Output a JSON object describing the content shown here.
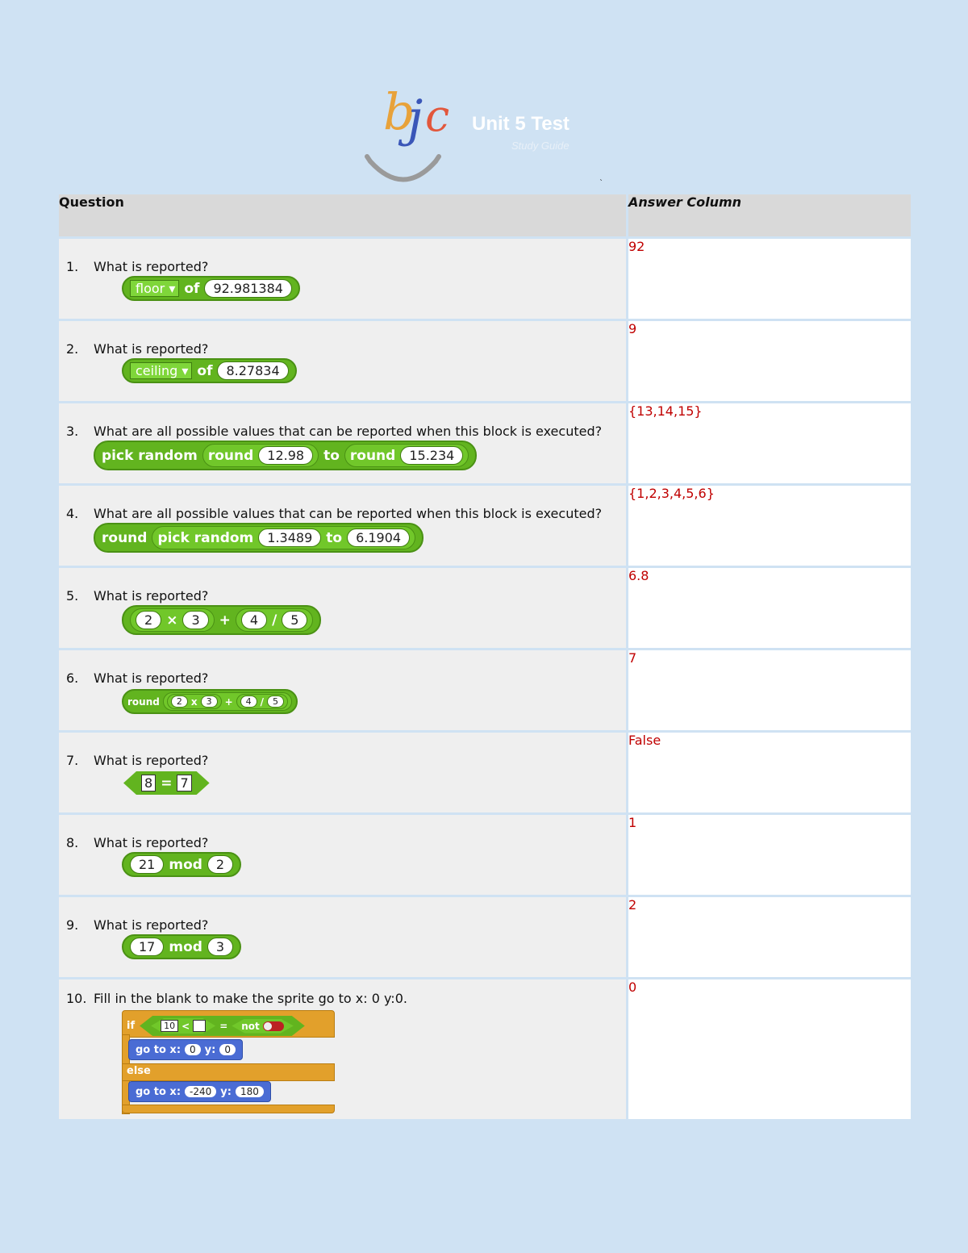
{
  "header": {
    "logo_text": "bjc",
    "title": "Unit 5 Test",
    "subtitle": "Study Guide",
    "tick_mark": "`"
  },
  "table": {
    "question_header": "Question",
    "answer_header": "Answer Column"
  },
  "questions": [
    {
      "num": "1.",
      "text": "What is reported?",
      "answer": "92",
      "block": {
        "op": "floor",
        "of": "of",
        "value": "92.981384"
      }
    },
    {
      "num": "2.",
      "text": "What is reported?",
      "answer": "9",
      "block": {
        "op": "ceiling",
        "of": "of",
        "value": "8.27834"
      }
    },
    {
      "num": "3.",
      "text": "What are all possible values that can be reported when this block is executed?",
      "answer": "{13,14,15}",
      "block": {
        "outer": "pick random",
        "round1": "round",
        "v1": "12.98",
        "to": "to",
        "round2": "round",
        "v2": "15.234"
      }
    },
    {
      "num": "4.",
      "text": "What are all possible values that can be reported when this block is executed?",
      "answer": "{1,2,3,4,5,6}",
      "block": {
        "outer": "round",
        "inner": "pick random",
        "v1": "1.3489",
        "to": "to",
        "v2": "6.1904"
      }
    },
    {
      "num": "5.",
      "text": "What is reported?",
      "answer": "6.8",
      "block": {
        "a": "2",
        "times": "×",
        "b": "3",
        "plus": "+",
        "c": "4",
        "div": "/",
        "d": "5"
      }
    },
    {
      "num": "6.",
      "text": "What is reported?",
      "answer": "7",
      "block": {
        "outer": "round",
        "a": "2",
        "times": "x",
        "b": "3",
        "plus": "+",
        "c": "4",
        "div": "/",
        "d": "5"
      }
    },
    {
      "num": "7.",
      "text": "What is reported?",
      "answer": "False",
      "block": {
        "a": "8",
        "eq": "=",
        "b": "7"
      }
    },
    {
      "num": "8.",
      "text": "What is reported?",
      "answer": "1",
      "block": {
        "a": "21",
        "op": "mod",
        "b": "2"
      }
    },
    {
      "num": "9.",
      "text": "What is reported?",
      "answer": "2",
      "block": {
        "a": "17",
        "op": "mod",
        "b": "3"
      }
    },
    {
      "num": "10.",
      "text": "Fill in the blank to make the sprite go to x: 0 y:0.",
      "answer": "0",
      "block": {
        "if": "if",
        "lt_a": "10",
        "lt": "<",
        "eq": "=",
        "not": "not",
        "goto1": "go to x:",
        "x1": "0",
        "y_label": "y:",
        "y1": "0",
        "else": "else",
        "goto2": "go to x:",
        "x2": "-240",
        "y2": "180"
      }
    }
  ],
  "colors": {
    "background": "#cfe2f3",
    "answer_text": "#c00000",
    "block_green": "#62b41f",
    "motion_blue": "#4a6cd4",
    "control_orange": "#e2a02b"
  }
}
